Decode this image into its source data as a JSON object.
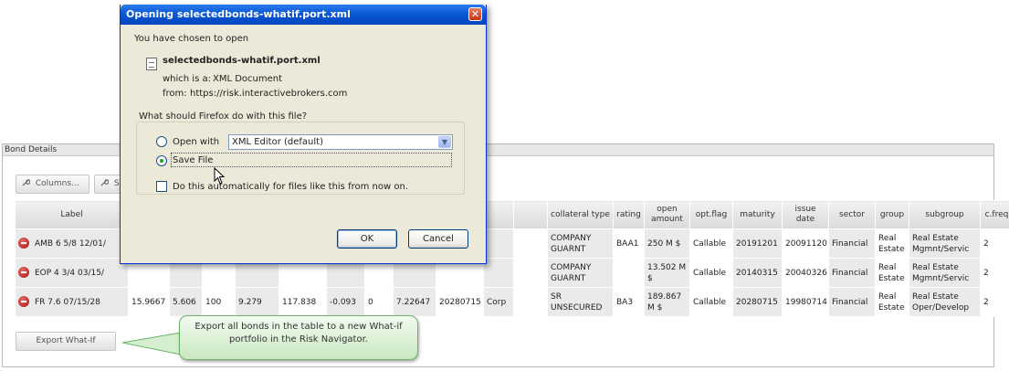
{
  "panel": {
    "title": "Bond Details",
    "columns_button": "Columns...",
    "second_button": "S",
    "export_button": "Export What-If"
  },
  "table": {
    "headers": [
      "Label",
      "",
      "",
      "",
      "",
      "",
      "",
      "",
      "",
      "",
      "",
      "",
      "collateral type",
      "rating",
      "open amount",
      "opt.flag",
      "maturity",
      "issue date",
      "sector",
      "group",
      "subgroup",
      "c.freq"
    ],
    "rows": [
      {
        "label": "AMB 6 5/8 12/01/",
        "c1": "",
        "c2": "",
        "c3": "",
        "c4": "",
        "c5": "",
        "c6": "",
        "c7": "",
        "c8": "",
        "c9": "",
        "c10": "",
        "collateral": "COMPANY GUARNT",
        "rating": "BAA1",
        "open_amount": "250 M $",
        "opt_flag": "Callable",
        "maturity": "20191201",
        "issue_date": "20091120",
        "sector": "Financial",
        "group": "Real Estate",
        "subgroup": "Real Estate Mgmnt/Servic",
        "cfreq": "2"
      },
      {
        "label": "EOP 4 3/4 03/15/",
        "c1": "",
        "c2": "",
        "c3": "",
        "c4": "",
        "c5": "",
        "c6": "",
        "c7": "",
        "c8": "",
        "c9": "",
        "c10": "",
        "collateral": "COMPANY GUARNT",
        "rating": "",
        "open_amount": "13.502 M $",
        "opt_flag": "Callable",
        "maturity": "20140315",
        "issue_date": "20040326",
        "sector": "Financial",
        "group": "Real Estate",
        "subgroup": "Real Estate Mgmnt/Servic",
        "cfreq": "2"
      },
      {
        "label": "FR 7.6 07/15/28",
        "c1": "15.9667",
        "c2": "5.606",
        "c3": "100",
        "c4": "9.279",
        "c5": "117.838",
        "c6": "-0.093",
        "c7": "0",
        "c8": "7.22647",
        "c9": "20280715",
        "c10": "Corp",
        "collateral": "SR UNSECURED",
        "rating": "BA3",
        "open_amount": "189.867 M $",
        "opt_flag": "Callable",
        "maturity": "20280715",
        "issue_date": "19980714",
        "sector": "Financial",
        "group": "Real Estate",
        "subgroup": "Real Estate Oper/Develop",
        "cfreq": "2"
      }
    ]
  },
  "callout": {
    "text": "Export all bonds in the table to a new What-if portfolio in the Risk Navigator."
  },
  "dialog": {
    "title": "Opening selectedbonds-whatif.port.xml",
    "close_label": "✕",
    "intro": "You have chosen to open",
    "filename": "selectedbonds-whatif.port.xml",
    "which_is_label": "which is a:",
    "which_is_value": "XML Document",
    "from_label": "from:",
    "from_value": "https://risk.interactivebrokers.com",
    "question": "What should Firefox do with this file?",
    "open_with_label": "Open with",
    "open_with_value": "XML Editor (default)",
    "save_file_label": "Save File",
    "save_file_selected": true,
    "auto_label": "Do this automatically for files like this from now on.",
    "ok_label": "OK",
    "cancel_label": "Cancel"
  }
}
